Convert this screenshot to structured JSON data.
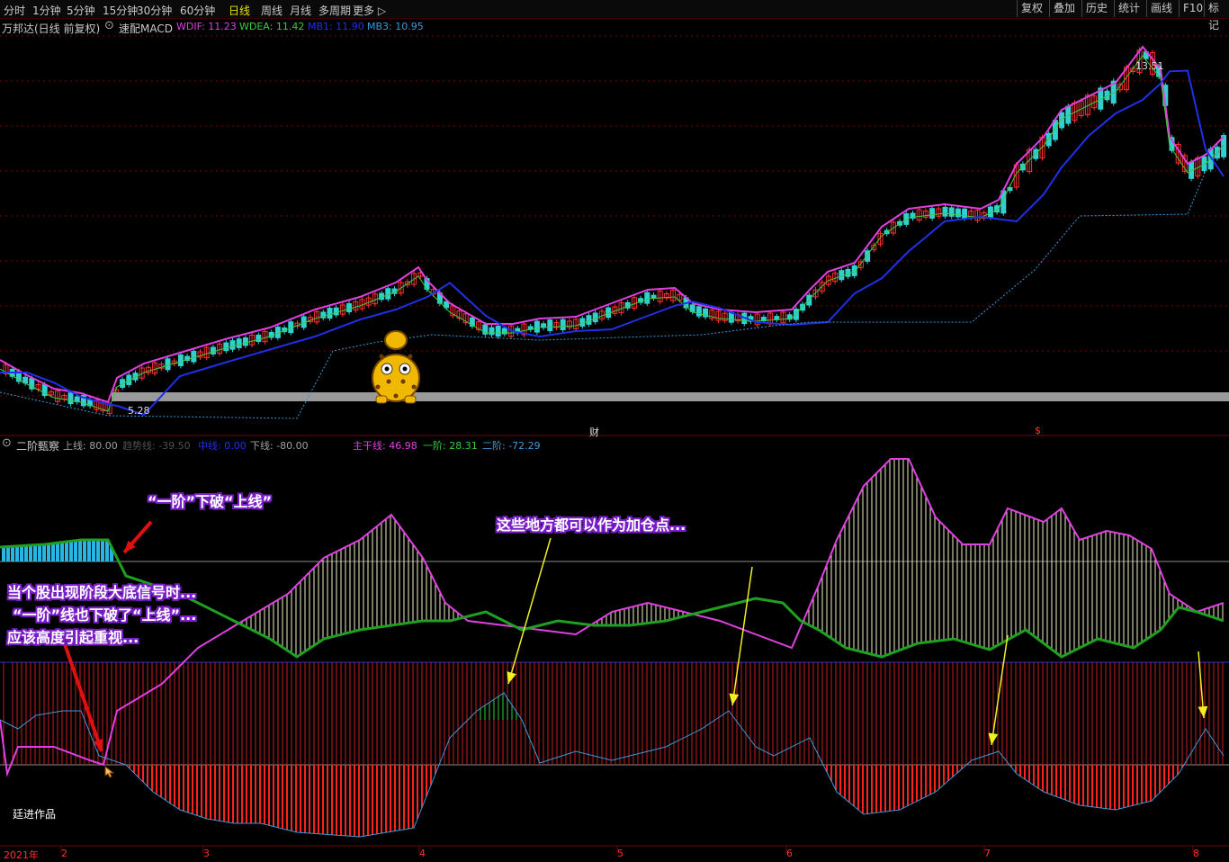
{
  "toolbar": {
    "periods": [
      "分时",
      "1分钟",
      "5分钟",
      "15分钟",
      "30分钟",
      "60分钟",
      "日线",
      "周线",
      "月线",
      "多周期",
      "更多 ▷"
    ],
    "active_period": "日线",
    "right_buttons": [
      "复权",
      "叠加",
      "历史",
      "统计",
      "画线",
      "F10",
      "标记"
    ]
  },
  "main_panel": {
    "title": "万邦达(日线 前复权)",
    "indicator": "速配MACD",
    "legend": [
      {
        "label": "WDIF: 11.23",
        "color": "#e040e0"
      },
      {
        "label": "WDEA: 11.42",
        "color": "#3ccc3c"
      },
      {
        "label": "MB1: 11.90",
        "color": "#2030e8"
      },
      {
        "label": "MB3: 10.95",
        "color": "#3a9ad9"
      }
    ],
    "high_label": "13.51",
    "low_label": "5.28",
    "marker_cai": "财",
    "marker_dollar": "$",
    "colors": {
      "up": "#ff3030",
      "down": "#30d0d0",
      "wdif": "#e040e0",
      "wdea": "#3ccc3c",
      "mb1": "#2030e8",
      "mb3": "#3a9ad9",
      "grid": "#7a0000"
    }
  },
  "lower_panel": {
    "indicator": "二阶甄察",
    "legend": [
      {
        "label": "上线: 80.00",
        "color": "#a0a0a0"
      },
      {
        "label": "趋势线: -39.50",
        "color": "#505050"
      },
      {
        "label": "中线: 0.00",
        "color": "#2030e8"
      },
      {
        "label": "下线: -80.00",
        "color": "#a0a0a0"
      },
      {
        "label": "主干线: 46.98",
        "color": "#e040e0"
      },
      {
        "label": "一阶: 28.31",
        "color": "#3ccc3c"
      },
      {
        "label": "二阶: -72.29",
        "color": "#3a9ad9"
      }
    ],
    "watermark": "廷进作品"
  },
  "annotations": {
    "a1": "“一阶”下破“上线”",
    "a2": "这些地方都可以作为加仓点...",
    "a3_line1": "当个股出现阶段大底信号时...",
    "a3_line2": "“一阶”线也下破了“上线”...",
    "a3_line3": "应该高度引起重视..."
  },
  "chart_data": {
    "type": "line",
    "title": "万邦达(日线 前复权)",
    "xlabel": "",
    "ylabel": "",
    "x_axis_labels": [
      "2021年",
      "2",
      "3",
      "4",
      "5",
      "6",
      "7",
      "8"
    ],
    "price_range": [
      5.28,
      13.51
    ],
    "series": [
      {
        "name": "主干线",
        "x": [
          0,
          10,
          20,
          30,
          40,
          50,
          60,
          70,
          80,
          90,
          100,
          110,
          120,
          130,
          140,
          150,
          160
        ],
        "values": [
          -10,
          -15,
          -8,
          25,
          55,
          72,
          48,
          35,
          40,
          20,
          10,
          88,
          70,
          75,
          68,
          60,
          46.98
        ]
      },
      {
        "name": "一阶",
        "x": [
          0,
          10,
          20,
          30,
          40,
          50,
          60,
          70,
          80,
          90,
          100,
          110,
          120,
          130,
          140,
          150,
          160
        ],
        "values": [
          80,
          80,
          45,
          10,
          15,
          20,
          25,
          18,
          20,
          22,
          30,
          10,
          8,
          12,
          15,
          18,
          28.31
        ]
      },
      {
        "name": "二阶",
        "x": [
          0,
          10,
          20,
          30,
          40,
          50,
          60,
          70,
          80,
          90,
          100,
          110,
          120,
          130,
          140,
          150,
          160
        ],
        "values": [
          20,
          10,
          -20,
          -50,
          -60,
          -30,
          20,
          -10,
          -20,
          15,
          -20,
          -40,
          -35,
          -10,
          -45,
          -10,
          -72.29
        ]
      }
    ],
    "levels": {
      "上线": 80.0,
      "中线": 0.0,
      "下线": -80.0,
      "趋势线": -39.5
    }
  }
}
